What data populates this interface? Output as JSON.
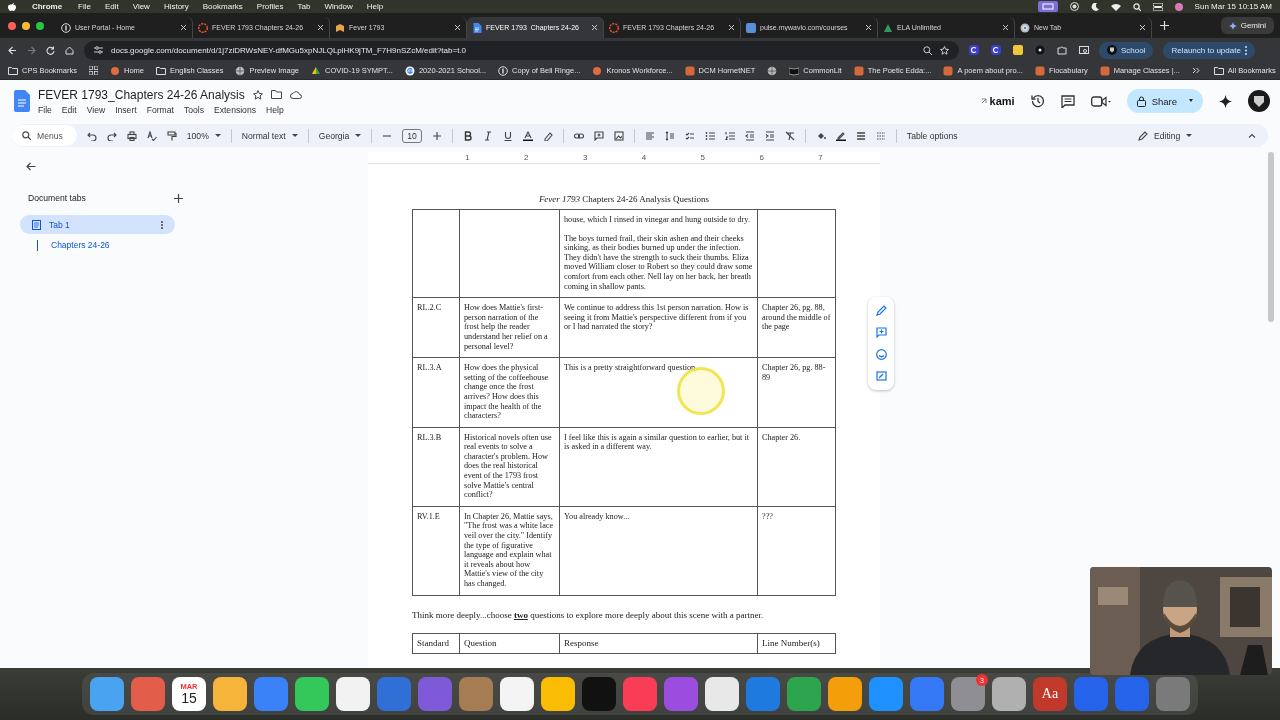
{
  "menu_bar": {
    "app": "Chrome",
    "items": [
      "File",
      "Edit",
      "View",
      "History",
      "Bookmarks",
      "Profiles",
      "Tab",
      "Window",
      "Help"
    ],
    "clock": "Sun Mar 15  10:15 AM"
  },
  "browser_tabs": [
    {
      "title": "User Portal - Home",
      "kind": "portal",
      "selected": false
    },
    {
      "title": "FEVER 1793 Chapters 24-26",
      "kind": "wheel",
      "selected": false
    },
    {
      "title": "Fever 1793",
      "kind": "book",
      "selected": false
    },
    {
      "title": "FEVER 1793_Chapters 24-26",
      "kind": "docs",
      "selected": true
    },
    {
      "title": "FEVER 1793 Chapters 24-26",
      "kind": "wheel",
      "selected": false
    },
    {
      "title": "pulse.mywavio.com/courses",
      "kind": "wavio",
      "selected": false
    },
    {
      "title": "ELA Unlimited",
      "kind": "ela",
      "selected": false
    },
    {
      "title": "New Tab",
      "kind": "chrome",
      "selected": false
    }
  ],
  "gemini": "Gemini",
  "address_bar": {
    "url": "docs.google.com/document/d/1j7ziDRWsNEY-dfMGu5xpNJLQLplHK9jTM_F7H9nSZcM/edit?tab=t.0"
  },
  "profile": "School",
  "relaunch": "Relaunch to update",
  "bookmarks": [
    {
      "label": "CPS Bookmarks",
      "kind": "folder"
    },
    {
      "label": "Home",
      "kind": "dot"
    },
    {
      "label": "English Classes",
      "kind": "folder"
    },
    {
      "label": "Preview Image",
      "kind": "globe"
    },
    {
      "label": "COVID-19 SYMPT...",
      "kind": "drive"
    },
    {
      "label": "2020-2021 School...",
      "kind": "google"
    },
    {
      "label": "Copy of Bell Ringe...",
      "kind": "portal"
    },
    {
      "label": "Kronos Workforce...",
      "kind": "dot"
    },
    {
      "label": "DCM HornetNET",
      "kind": "square"
    },
    {
      "label": "CommonLit",
      "kind": "book"
    },
    {
      "label": "The Poetic Edda:...",
      "kind": "square"
    },
    {
      "label": "A poem about pro...",
      "kind": "square"
    },
    {
      "label": "Flocabulary",
      "kind": "square"
    },
    {
      "label": "Manage Classes |...",
      "kind": "square"
    }
  ],
  "all_bookmarks": "All Bookmarks",
  "document": {
    "title": "FEVER 1793_Chapters 24-26 Analysis",
    "menus": [
      "File",
      "Edit",
      "View",
      "Insert",
      "Format",
      "Tools",
      "Extensions",
      "Help"
    ]
  },
  "kami": "kami",
  "share": "Share",
  "toolbar": {
    "search": "Menus",
    "zoom": "100%",
    "style": "Normal text",
    "font": "Georgia",
    "size": "10",
    "table_options": "Table options",
    "mode": "Editing"
  },
  "sidebar": {
    "heading": "Document tabs",
    "tabs": [
      {
        "label": "Tab 1",
        "selected": true,
        "children": [
          {
            "label": "Chapters 24-26"
          }
        ]
      }
    ]
  },
  "ruler": [
    "1",
    "2",
    "3",
    "4",
    "5",
    "6",
    "7"
  ],
  "page": {
    "heading": "*Fever 1793* Chapters 24-26 Analysis Questions",
    "table": {
      "rows": [
        {
          "response": [
            "house, which I rinsed in vinegar and hung outside to dry.",
            "The boys turned frail, their skin ashen and their cheeks sinking, as their bodies burned up under the infection. They didn't have the strength to suck their thumbs. Eliza moved William closer to Robert so they could draw some comfort from each other. Nell lay on her back, her breath coming in shallow pants."
          ]
        },
        {
          "standard": "RL.2.C",
          "question": "How does Mattie's first-person narration of the frost help the reader understand her relief on a personal level?",
          "response": [
            "We continue to address this 1st person narration. How is seeing it from Mattie's perspective different from if you or I had narrated the story?"
          ],
          "lines": "Chapter 26, pg. 88, around the middle of the page"
        },
        {
          "standard": "RL.3.A",
          "question": "How does the physical setting of the coffeehouse change once the frost arrives? How does this impact the health of the characters?",
          "response": [
            "This is a pretty straightforward question"
          ],
          "lines": "Chapter 26, pg. 88-89"
        },
        {
          "standard": "RL.3.B",
          "question": "Historical novels often use real events to solve a character's problem. How does the real historical event of the 1793 frost solve Mattie's central conflict?",
          "response": [
            "I feel like this is again a similar question to earlier, but it is asked in a different way."
          ],
          "lines": "Chapter 26."
        },
        {
          "standard": "RV.1.E",
          "question": "In Chapter 26, Mattie says, \"The frost was a white lace veil over the city.\" Identify the type of figurative language and explain what it reveals about how Mattie's view of the city has changed.",
          "response": [
            "You already know..."
          ],
          "lines": "???"
        }
      ]
    },
    "prompt": "Think more deeply...choose **two** questions to explore more deeply about this scene with a partner.",
    "table_2": {
      "columns": [
        "Standard",
        "Question",
        "Response",
        "Line Number(s)"
      ]
    }
  },
  "dock": {
    "calendar_month": "MAR",
    "calendar_day": "15",
    "badge": "3",
    "dictionary": "Aa"
  }
}
